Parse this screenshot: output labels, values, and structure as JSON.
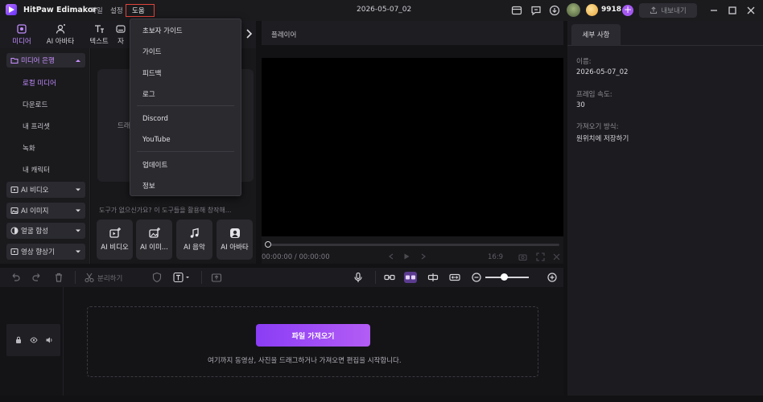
{
  "app": {
    "name": "HitPaw Edimakor",
    "document_title": "2026-05-07_02"
  },
  "menubar": {
    "items": [
      "파일",
      "설정",
      "도움"
    ],
    "active_index": 2
  },
  "header": {
    "coins": "9918",
    "export_label": "내보내기"
  },
  "media_tabs": [
    {
      "label": "미디어",
      "icon": "media-icon"
    },
    {
      "label": "AI 아바타",
      "icon": "avatar-icon"
    },
    {
      "label": "텍스트",
      "icon": "text-icon"
    },
    {
      "label": "자",
      "icon": "subtitle-icon"
    }
  ],
  "sidebar": {
    "section": "미디어 은행",
    "items": [
      "로컬 미디어",
      "다운로드",
      "내 프리셋",
      "녹화",
      "내 캐릭터"
    ],
    "active_index": 0,
    "groups": [
      "AI 비디오",
      "AI 이미지",
      "얼굴 합성",
      "영상 향상기"
    ]
  },
  "media_panel": {
    "drop_text": "드래",
    "hint": "도구가 없으신가요? 이 도구들을 활용해 창작해...",
    "ai_cards": [
      {
        "label": "AI 비디오",
        "icon": "ai-video-icon"
      },
      {
        "label": "AI 이미...",
        "icon": "ai-image-icon"
      },
      {
        "label": "AI 음악",
        "icon": "ai-music-icon"
      },
      {
        "label": "AI 아바타",
        "icon": "ai-avatar-icon"
      }
    ]
  },
  "player": {
    "label": "플레이어",
    "time": "00:00:00 / 00:00:00",
    "ratio": "16:9"
  },
  "details": {
    "tab": "세부 사항",
    "fields": [
      {
        "label": "이름:",
        "value": "2026-05-07_02"
      },
      {
        "label": "프레임 속도:",
        "value": "30"
      },
      {
        "label": "가져오기 방식:",
        "value": "원위치에 저장하기"
      }
    ]
  },
  "timeline": {
    "split_label": "분리하기",
    "import_button": "파일 가져오기",
    "import_hint": "여기까지 동영상, 사진을 드래그하거나 가져오면 편집을 시작합니다."
  },
  "help_menu": {
    "items": [
      "초보자 가이드",
      "가이드",
      "피드백",
      "로그",
      "Discord",
      "YouTube",
      "업데이트",
      "정보"
    ]
  },
  "colors": {
    "accent": "#a458f0",
    "highlight_border": "#e0443c",
    "background": "#121214"
  }
}
